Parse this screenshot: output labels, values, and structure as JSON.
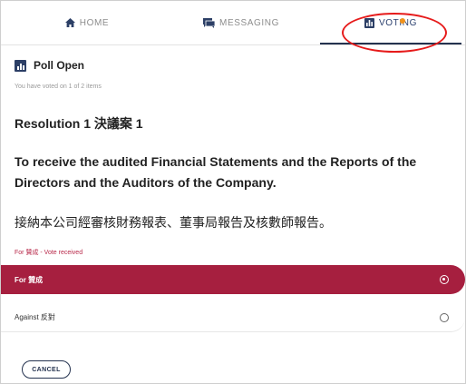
{
  "tabs": {
    "home": "HOME",
    "messaging": "MESSAGING",
    "voting": "VOTING"
  },
  "poll": {
    "title": "Poll Open",
    "voted_count": "You have voted on 1 of 2 items"
  },
  "resolution": {
    "title": "Resolution 1 決議案 1",
    "text_en": "To receive the audited Financial Statements and the Reports of the Directors and the Auditors of the Company.",
    "text_zh": "接納本公司經審核財務報表、董事局報告及核數師報告。"
  },
  "vote_status": "For 贊成 - Vote received",
  "options": [
    {
      "label": "For 贊成",
      "selected": true
    },
    {
      "label": "Against 反對",
      "selected": false
    }
  ],
  "cancel_label": "CANCEL",
  "colors": {
    "accent": "#a61f3f",
    "navy": "#24324f",
    "notification": "#f0921b",
    "annotation_ring": "#e61b1b"
  },
  "icons": {
    "home": "home-icon",
    "messaging": "message-icon",
    "voting": "poll-icon"
  }
}
